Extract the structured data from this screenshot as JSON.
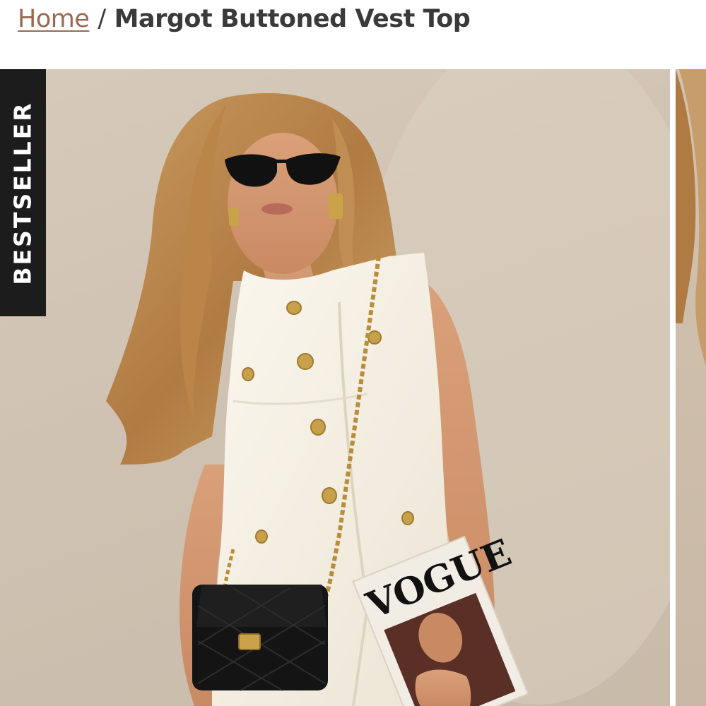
{
  "breadcrumb": {
    "home_label": "Home",
    "separator": "/",
    "current_label": "Margot Buttoned Vest Top"
  },
  "product_image": {
    "badge_text": "BESTSELLER",
    "magazine_title": "VOGUE"
  },
  "colors": {
    "link": "#9a6a52",
    "text": "#3a3a3a",
    "badge_bg": "#1c1c1c",
    "photo_bg": "#d2c5b5"
  }
}
